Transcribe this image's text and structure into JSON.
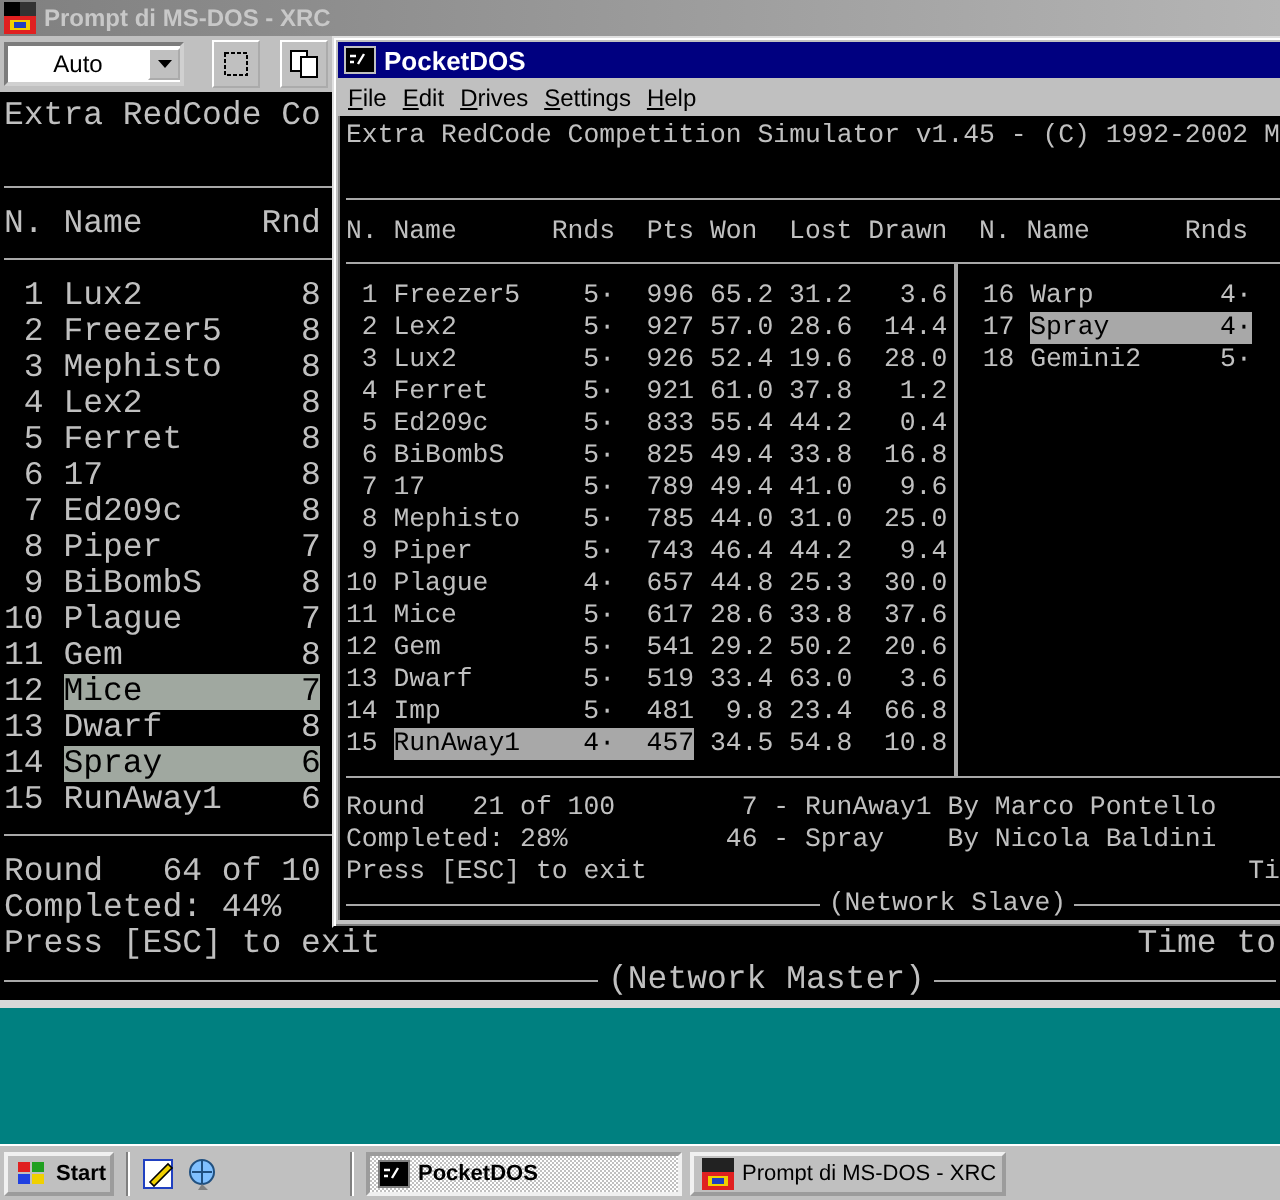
{
  "ms_dos_window": {
    "title": "Prompt di MS-DOS - XRC",
    "font_size": "Auto",
    "console": {
      "heading": "Extra RedCode Co",
      "columns": [
        "N.",
        "Name",
        "Rnd"
      ],
      "rows": [
        {
          "n": "1",
          "name": "Lux2",
          "rnds": "8",
          "selected": false
        },
        {
          "n": "2",
          "name": "Freezer5",
          "rnds": "8",
          "selected": false
        },
        {
          "n": "3",
          "name": "Mephisto",
          "rnds": "8",
          "selected": false
        },
        {
          "n": "4",
          "name": "Lex2",
          "rnds": "8",
          "selected": false
        },
        {
          "n": "5",
          "name": "Ferret",
          "rnds": "8",
          "selected": false
        },
        {
          "n": "6",
          "name": "17",
          "rnds": "8",
          "selected": false
        },
        {
          "n": "7",
          "name": "Ed209c",
          "rnds": "8",
          "selected": false
        },
        {
          "n": "8",
          "name": "Piper",
          "rnds": "7",
          "selected": false
        },
        {
          "n": "9",
          "name": "BiBombS",
          "rnds": "8",
          "selected": false
        },
        {
          "n": "10",
          "name": "Plague",
          "rnds": "7",
          "selected": false
        },
        {
          "n": "11",
          "name": "Gem",
          "rnds": "8",
          "selected": false
        },
        {
          "n": "12",
          "name": "Mice",
          "rnds": "7",
          "selected": true
        },
        {
          "n": "13",
          "name": "Dwarf",
          "rnds": "8",
          "selected": false
        },
        {
          "n": "14",
          "name": "Spray",
          "rnds": "6",
          "selected": true
        },
        {
          "n": "15",
          "name": "RunAway1",
          "rnds": "6",
          "selected": false
        }
      ],
      "round": "Round   64 of 10",
      "completed": "Completed: 44%",
      "exit_hint": "Press [ESC] to exit",
      "time_label": "Time to",
      "footer": "(Network Master)"
    }
  },
  "pocketdos_window": {
    "title": "PocketDOS",
    "menu": [
      "File",
      "Edit",
      "Drives",
      "Settings",
      "Help"
    ],
    "console": {
      "heading": "Extra RedCode Competition Simulator v1.45 - (C) 1992-2002 M",
      "columns": [
        "N.",
        "Name",
        "Rnds",
        "Pts",
        "Won",
        "Lost",
        "Drawn"
      ],
      "side_columns": [
        "N.",
        "Name",
        "Rnds"
      ],
      "rows": [
        {
          "n": "1",
          "name": "Freezer5",
          "rnds": "5·",
          "pts": "996",
          "won": "65.2",
          "lost": "31.2",
          "drawn": "3.6",
          "selected": false
        },
        {
          "n": "2",
          "name": "Lex2",
          "rnds": "5·",
          "pts": "927",
          "won": "57.0",
          "lost": "28.6",
          "drawn": "14.4",
          "selected": false
        },
        {
          "n": "3",
          "name": "Lux2",
          "rnds": "5·",
          "pts": "926",
          "won": "52.4",
          "lost": "19.6",
          "drawn": "28.0",
          "selected": false
        },
        {
          "n": "4",
          "name": "Ferret",
          "rnds": "5·",
          "pts": "921",
          "won": "61.0",
          "lost": "37.8",
          "drawn": "1.2",
          "selected": false
        },
        {
          "n": "5",
          "name": "Ed209c",
          "rnds": "5·",
          "pts": "833",
          "won": "55.4",
          "lost": "44.2",
          "drawn": "0.4",
          "selected": false
        },
        {
          "n": "6",
          "name": "BiBombS",
          "rnds": "5·",
          "pts": "825",
          "won": "49.4",
          "lost": "33.8",
          "drawn": "16.8",
          "selected": false
        },
        {
          "n": "7",
          "name": "17",
          "rnds": "5·",
          "pts": "789",
          "won": "49.4",
          "lost": "41.0",
          "drawn": "9.6",
          "selected": false
        },
        {
          "n": "8",
          "name": "Mephisto",
          "rnds": "5·",
          "pts": "785",
          "won": "44.0",
          "lost": "31.0",
          "drawn": "25.0",
          "selected": false
        },
        {
          "n": "9",
          "name": "Piper",
          "rnds": "5·",
          "pts": "743",
          "won": "46.4",
          "lost": "44.2",
          "drawn": "9.4",
          "selected": false
        },
        {
          "n": "10",
          "name": "Plague",
          "rnds": "4·",
          "pts": "657",
          "won": "44.8",
          "lost": "25.3",
          "drawn": "30.0",
          "selected": false
        },
        {
          "n": "11",
          "name": "Mice",
          "rnds": "5·",
          "pts": "617",
          "won": "28.6",
          "lost": "33.8",
          "drawn": "37.6",
          "selected": false
        },
        {
          "n": "12",
          "name": "Gem",
          "rnds": "5·",
          "pts": "541",
          "won": "29.2",
          "lost": "50.2",
          "drawn": "20.6",
          "selected": false
        },
        {
          "n": "13",
          "name": "Dwarf",
          "rnds": "5·",
          "pts": "519",
          "won": "33.4",
          "lost": "63.0",
          "drawn": "3.6",
          "selected": false
        },
        {
          "n": "14",
          "name": "Imp",
          "rnds": "5·",
          "pts": "481",
          "won": "9.8",
          "lost": "23.4",
          "drawn": "66.8",
          "selected": false
        },
        {
          "n": "15",
          "name": "RunAway1",
          "rnds": "4·",
          "pts": "457",
          "won": "34.5",
          "lost": "54.8",
          "drawn": "10.8",
          "selected": true
        }
      ],
      "side_rows": [
        {
          "n": "16",
          "name": "Warp",
          "rnds": "4·",
          "selected": false
        },
        {
          "n": "17",
          "name": "Spray",
          "rnds": "4·",
          "selected": true
        },
        {
          "n": "18",
          "name": "Gemini2",
          "rnds": "5·",
          "selected": false
        }
      ],
      "round": "Round   21 of 100",
      "completed": "Completed: 28%",
      "matches": [
        {
          "number": "7",
          "title": "- RunAway1",
          "author": "By Marco Pontello"
        },
        {
          "number": "46",
          "title": "- Spray",
          "author": "By Nicola Baldini"
        }
      ],
      "exit_hint": "Press [ESC] to exit",
      "time_label": "Ti",
      "footer": "(Network Slave)"
    }
  },
  "taskbar": {
    "start": "Start",
    "tasks": [
      {
        "label": "PocketDOS",
        "selected": true
      },
      {
        "label": "Prompt di MS-DOS - XRC",
        "selected": false
      }
    ]
  }
}
